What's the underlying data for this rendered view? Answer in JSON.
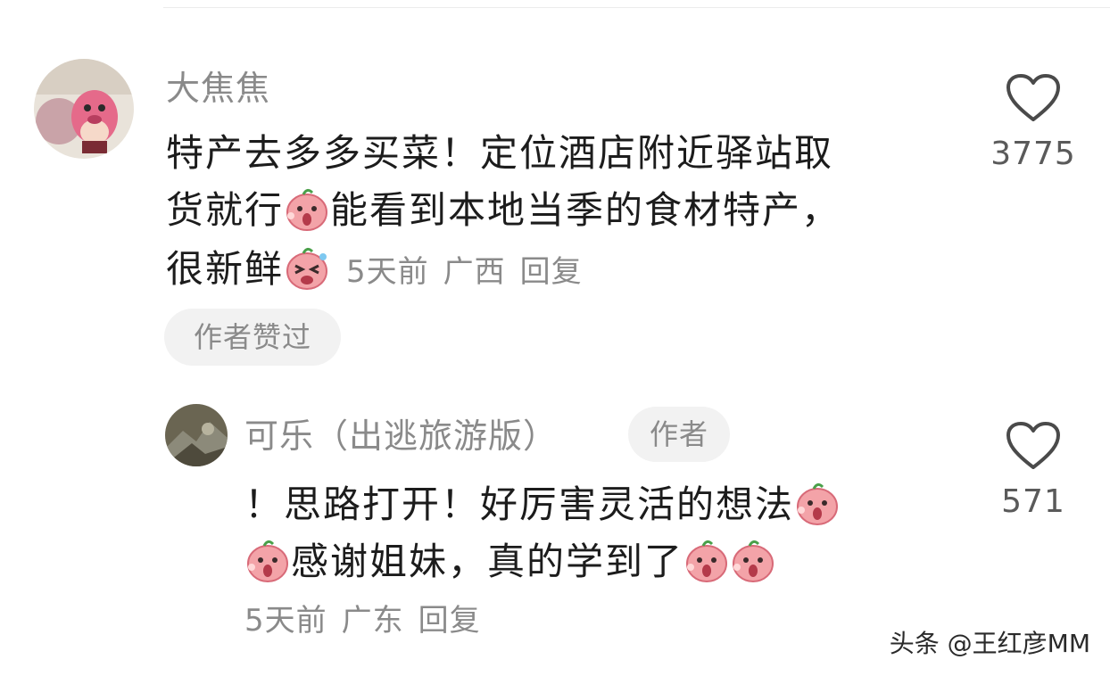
{
  "comment": {
    "username": "大焦焦",
    "lines": [
      "特产去多多买菜！定位酒店附近驿站取",
      "货就行",
      "能看到本地当季的食材特产，",
      "很新鲜"
    ],
    "time": "5天前",
    "location": "广西",
    "reply_label": "回复",
    "author_liked_label": "作者赞过",
    "like_count": "3775"
  },
  "reply": {
    "username": "可乐（出逃旅游版）",
    "author_badge": "作者",
    "lines": [
      "！思路打开！好厉害灵活的想法",
      "感谢姐妹，真的学到了"
    ],
    "time": "5天前",
    "location": "广东",
    "reply_label": "回复",
    "like_count": "571"
  },
  "watermark": "头条 @王红彦MM",
  "icons": [
    "heart-outline-icon",
    "shock-emoji-icon",
    "laugh-emoji-icon"
  ],
  "colors": {
    "meta_text": "#8a8a8a",
    "chip_bg": "#f2f2f2",
    "emoji_pink": "#f3a3a8"
  }
}
